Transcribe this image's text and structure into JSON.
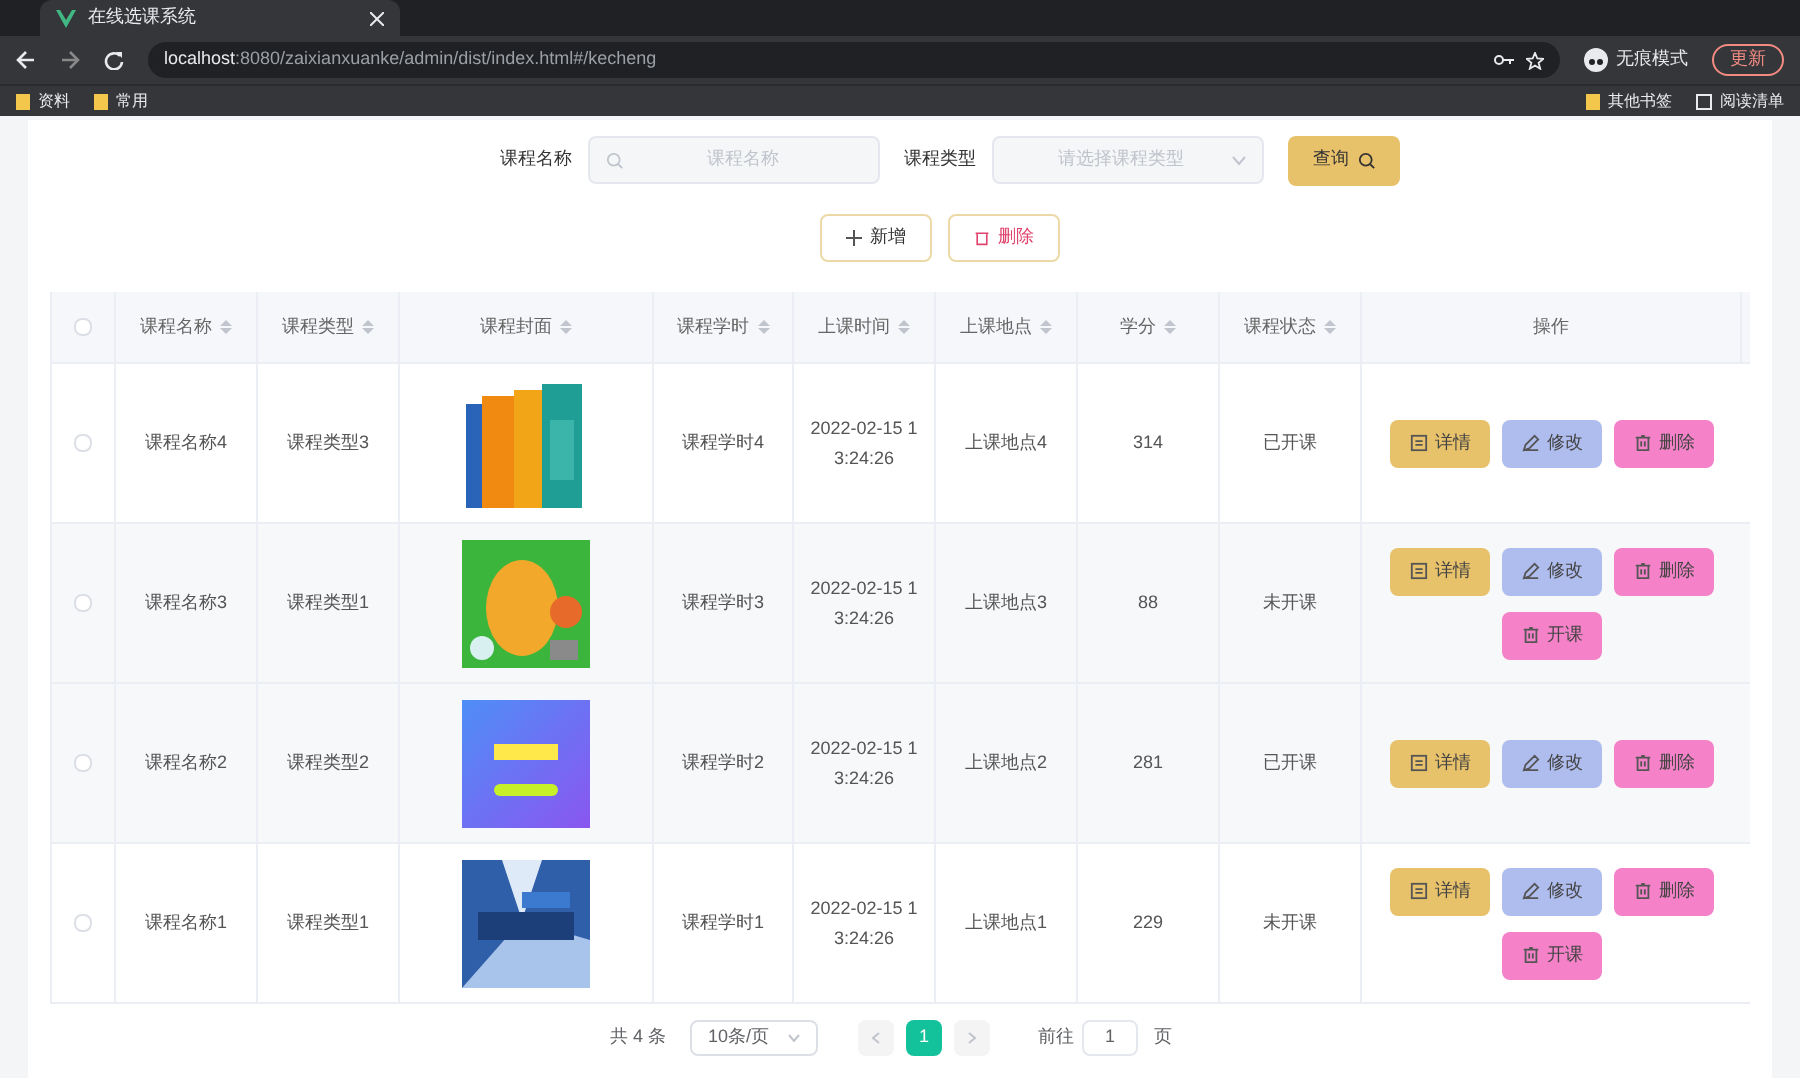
{
  "browser": {
    "tab_title": "在线选课系统",
    "url_host": "localhost",
    "url_path": ":8080/zaixianxuanke/admin/dist/index.html#/kecheng",
    "incognito": "无痕模式",
    "update": "更新",
    "bookmarks_left": [
      "资料",
      "常用"
    ],
    "bookmarks_right": [
      "其他书签",
      "阅读清单"
    ]
  },
  "search": {
    "name_label": "课程名称",
    "name_placeholder": "课程名称",
    "type_label": "课程类型",
    "type_placeholder": "请选择课程类型",
    "query_button": "查询"
  },
  "toolbar": {
    "add_button": "新增",
    "delete_button": "删除"
  },
  "table": {
    "all_checked": false,
    "columns": [
      {
        "label": "课程名称",
        "sortable": true
      },
      {
        "label": "课程类型",
        "sortable": true
      },
      {
        "label": "课程封面",
        "sortable": true
      },
      {
        "label": "课程学时",
        "sortable": true
      },
      {
        "label": "上课时间",
        "sortable": true
      },
      {
        "label": "上课地点",
        "sortable": true
      },
      {
        "label": "学分",
        "sortable": true
      },
      {
        "label": "课程状态",
        "sortable": true
      },
      {
        "label": "操作",
        "sortable": false
      }
    ],
    "rows": [
      {
        "checked": false,
        "name": "课程名称4",
        "type": "课程类型3",
        "cover": {
          "kind": "picture"
        },
        "hours": "课程学时4",
        "time": "2022-02-15 13:24:26",
        "place": "上课地点4",
        "credit": "314",
        "status": "已开课",
        "actions": [
          {
            "kind": "detail",
            "label": "详情"
          },
          {
            "kind": "edit",
            "label": "修改"
          },
          {
            "kind": "delete",
            "label": "删除"
          }
        ]
      },
      {
        "checked": false,
        "name": "课程名称3",
        "type": "课程类型1",
        "cover": {
          "kind": "picture"
        },
        "hours": "课程学时3",
        "time": "2022-02-15 13:24:26",
        "place": "上课地点3",
        "credit": "88",
        "status": "未开课",
        "actions": [
          {
            "kind": "detail",
            "label": "详情"
          },
          {
            "kind": "edit",
            "label": "修改"
          },
          {
            "kind": "delete",
            "label": "删除"
          },
          {
            "kind": "open",
            "label": "开课"
          }
        ]
      },
      {
        "checked": false,
        "name": "课程名称2",
        "type": "课程类型2",
        "cover": {
          "kind": "picture"
        },
        "hours": "课程学时2",
        "time": "2022-02-15 13:24:26",
        "place": "上课地点2",
        "credit": "281",
        "status": "已开课",
        "actions": [
          {
            "kind": "detail",
            "label": "详情"
          },
          {
            "kind": "edit",
            "label": "修改"
          },
          {
            "kind": "delete",
            "label": "删除"
          }
        ]
      },
      {
        "checked": false,
        "name": "课程名称1",
        "type": "课程类型1",
        "cover": {
          "kind": "picture"
        },
        "hours": "课程学时1",
        "time": "2022-02-15 13:24:26",
        "place": "上课地点1",
        "credit": "229",
        "status": "未开课",
        "actions": [
          {
            "kind": "detail",
            "label": "详情"
          },
          {
            "kind": "edit",
            "label": "修改"
          },
          {
            "kind": "delete",
            "label": "删除"
          },
          {
            "kind": "open",
            "label": "开课"
          }
        ]
      }
    ]
  },
  "pagination": {
    "total": "共 4 条",
    "page_size": "10条/页",
    "pages": [
      {
        "label": "1",
        "selected": true
      }
    ],
    "goto_label": "前往",
    "goto_value": "1",
    "goto_unit": "页"
  }
}
